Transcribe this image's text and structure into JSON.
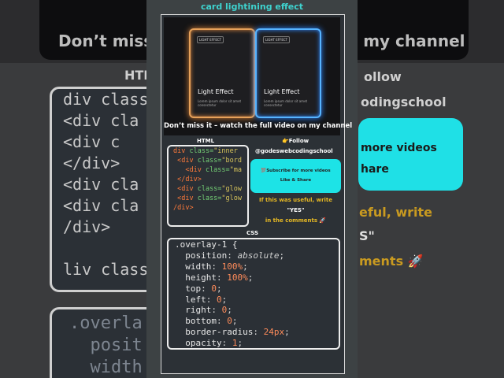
{
  "background": {
    "title_left": "Don’t miss it",
    "title_right": "n my channel",
    "label_html": "HTML",
    "label_follow": "ollow",
    "label_school": "odingschool",
    "code_lines": [
      "div class",
      "<div cla",
      "<div c",
      "</div>",
      "<div cla",
      "<div cla",
      "/div>",
      "",
      "liv class"
    ],
    "cyan_line1": "more videos",
    "cyan_line2": "hare",
    "right_useful": "eful, write",
    "right_yes": "S\"",
    "right_comments": "ments 🚀",
    "css_lines": [
      ".overla",
      "  posit",
      "  width"
    ]
  },
  "title": "card lightining effect",
  "preview": {
    "card_left": {
      "tag": "LIGHT EFFECT",
      "title": "Light Effect",
      "sub": "Lorem ipsum dolor sit amet consectetur"
    },
    "card_right": {
      "tag": "LIGHT EFFECT",
      "title": "Light Effect",
      "sub": "Lorem ipsum dolor sit amet consectetur"
    },
    "caption": "Don’t miss it – watch the full video on my channel"
  },
  "html_section": {
    "label": "HTML",
    "lines": [
      {
        "a": "div",
        "b": " class=",
        "c": "\"inner"
      },
      {
        "a": " <div",
        "b": " class=",
        "c": "\"bord"
      },
      {
        "a": "   <div",
        "b": " class=",
        "c": "\"ma"
      },
      {
        "a": " </div>",
        "b": "",
        "c": ""
      },
      {
        "a": " <div",
        "b": " class=",
        "c": "\"glow"
      },
      {
        "a": " <div",
        "b": " class=",
        "c": "\"glow"
      },
      {
        "a": "/div>",
        "b": "",
        "c": ""
      }
    ]
  },
  "promo": {
    "follow": "👉Follow",
    "handle": "@godeswebcodingschool",
    "button_line1": "💯Subscribe for more videos",
    "button_line2": "Like & Share",
    "useful_line1": "If this was useful, write",
    "useful_line2": "\"YES\"",
    "useful_line3": "in the comments 🚀"
  },
  "css_section": {
    "label": "CSS",
    "selector": ".overlay-1 {",
    "props": [
      {
        "p": "position",
        "v": "absolute",
        "kw": true
      },
      {
        "p": "width",
        "v": "100%",
        "kw": false
      },
      {
        "p": "height",
        "v": "100%",
        "kw": false
      },
      {
        "p": "top",
        "v": "0",
        "kw": false
      },
      {
        "p": "left",
        "v": "0",
        "kw": false
      },
      {
        "p": "right",
        "v": "0",
        "kw": false
      },
      {
        "p": "bottom",
        "v": "0",
        "kw": false
      },
      {
        "p": "border-radius",
        "v": "24px",
        "kw": false
      },
      {
        "p": "opacity",
        "v": "1",
        "kw": false
      }
    ]
  },
  "colors": {
    "accent": "#3ed3cf",
    "cyan_button": "#1de3e6",
    "yellow_text": "#e7b923"
  }
}
